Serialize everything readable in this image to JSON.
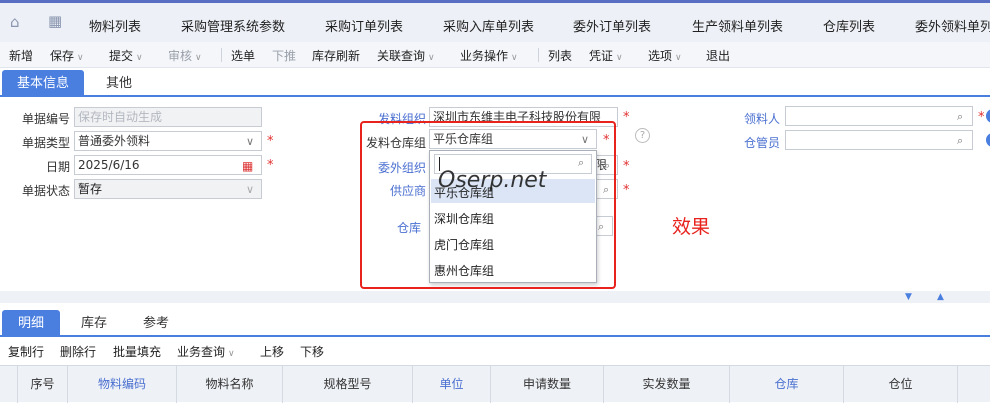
{
  "top_tabs": [
    "物料列表",
    "采购管理系统参数",
    "采购订单列表",
    "采购入库单列表",
    "委外订单列表",
    "生产领料单列表",
    "仓库列表",
    "委外领料单列"
  ],
  "toolbar": {
    "new": "新增",
    "save": "保存",
    "submit": "提交",
    "audit": "审核",
    "select_order": "选单",
    "push_down": "下推",
    "refresh_stock": "库存刷新",
    "related_query": "关联查询",
    "business_op": "业务操作",
    "list": "列表",
    "voucher": "凭证",
    "options": "选项",
    "exit": "退出"
  },
  "main_tabs": {
    "basic": "基本信息",
    "other": "其他"
  },
  "form": {
    "bill_no_label": "单据编号",
    "bill_no_placeholder": "保存时自动生成",
    "bill_type_label": "单据类型",
    "bill_type_value": "普通委外领料",
    "date_label": "日期",
    "date_value": "2025/6/16",
    "status_label": "单据状态",
    "status_value": "暂存",
    "issue_org_label": "发料组织",
    "issue_org_value": "深圳市东维丰电子科技股份有限",
    "issue_wh_group_label": "发料仓库组",
    "issue_wh_group_value": "平乐仓库组",
    "outsource_org_label": "委外组织",
    "outsource_org_tail": "限",
    "supplier_label": "供应商",
    "warehouse_label": "仓库",
    "picker_label": "领料人",
    "keeper_label": "仓管员",
    "help_icon": "?"
  },
  "dropdown": {
    "search_value": "",
    "items": [
      "平乐仓库组",
      "深圳仓库组",
      "虎门仓库组",
      "惠州仓库组"
    ]
  },
  "annotation": {
    "watermark": "Oserp.net",
    "effect": "效果"
  },
  "bottom_tabs": {
    "detail": "明细",
    "stock": "库存",
    "ref": "参考"
  },
  "detail_toolbar": {
    "copy_row": "复制行",
    "delete_row": "删除行",
    "batch_fill": "批量填充",
    "biz_query": "业务查询",
    "move_up": "上移",
    "move_down": "下移"
  },
  "grid_headers": [
    "序号",
    "物料编码",
    "物料名称",
    "规格型号",
    "单位",
    "申请数量",
    "实发数量",
    "仓库",
    "仓位"
  ],
  "colors": {
    "accent": "#4a7fe0",
    "required": "#e0302e",
    "highlight": "#e8231e"
  }
}
